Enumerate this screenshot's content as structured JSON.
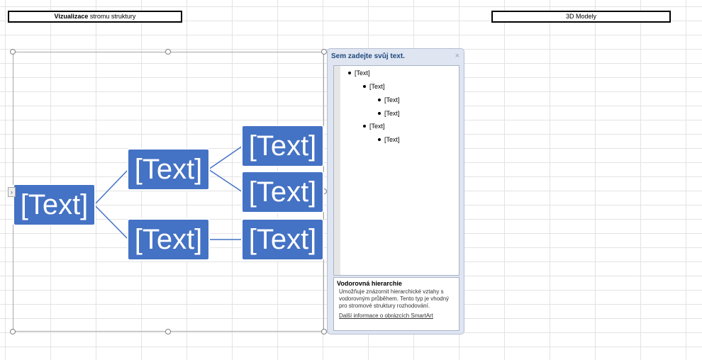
{
  "sheet": {
    "title_left_bold": "Vizualizace",
    "title_left_rest": " stromu struktury",
    "title_right": "3D Modely"
  },
  "smartart": {
    "nodes": {
      "root": "[Text]",
      "level2_a": "[Text]",
      "level2_b": "[Text]",
      "level3_a1": "[Text]",
      "level3_a2": "[Text]",
      "level3_b1": "[Text]"
    },
    "pane_toggle_icon": "chevron-right-icon",
    "node_color": "#4472c4"
  },
  "text_pane": {
    "title": "Sem zadejte svůj text.",
    "close_icon": "×",
    "bullets": [
      "[Text]",
      "[Text]",
      "[Text]",
      "[Text]",
      "[Text]",
      "[Text]"
    ],
    "desc_title": "Vodorovná hierarchie",
    "desc_body": "Umožňuje znázornit hierarchické vztahy s vodorovným průběhem. Tento typ je vhodný pro stromové struktury rozhodování.",
    "desc_link": "Další informace o obrázcích SmartArt"
  }
}
